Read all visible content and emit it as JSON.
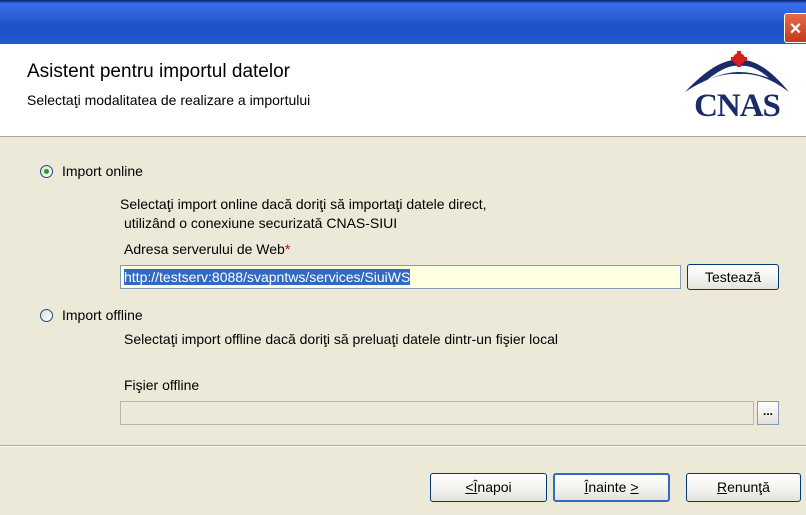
{
  "window": {
    "close_symbol": "×"
  },
  "header": {
    "title": "Asistent pentru importul datelor",
    "subtitle": "Selectaţi modalitatea de realizare a importului",
    "logo_text": "CNAS",
    "logo_color": "#1a2b6a",
    "logo_accent_color": "#d42020"
  },
  "online": {
    "label": "Import online",
    "checked": true,
    "description_line1": "Selectaţi import online dacă doriţi să importaţi datele direct,",
    "description_line2": "utilizând o conexiune securizată CNAS-SIUI",
    "url_label": "Adresa serverului de Web",
    "required_mark": "*",
    "url_value": "http://testserv:8088/svapntws/services/SiuiWS",
    "test_button": "Testează"
  },
  "offline": {
    "label": "Import offline",
    "checked": false,
    "description": "Selectaţi import offline dacă doriţi să preluaţi datele dintr-un fişier local",
    "file_label": "Fişier offline",
    "file_value": "",
    "browse_button": "..."
  },
  "footer": {
    "back_underline": "Î",
    "back_rest": "napoi",
    "back_prefix": "<",
    "next_underline": "Î",
    "next_rest": "nainte",
    "next_suffix": ">",
    "cancel_underline": "R",
    "cancel_rest": "enunţă"
  }
}
